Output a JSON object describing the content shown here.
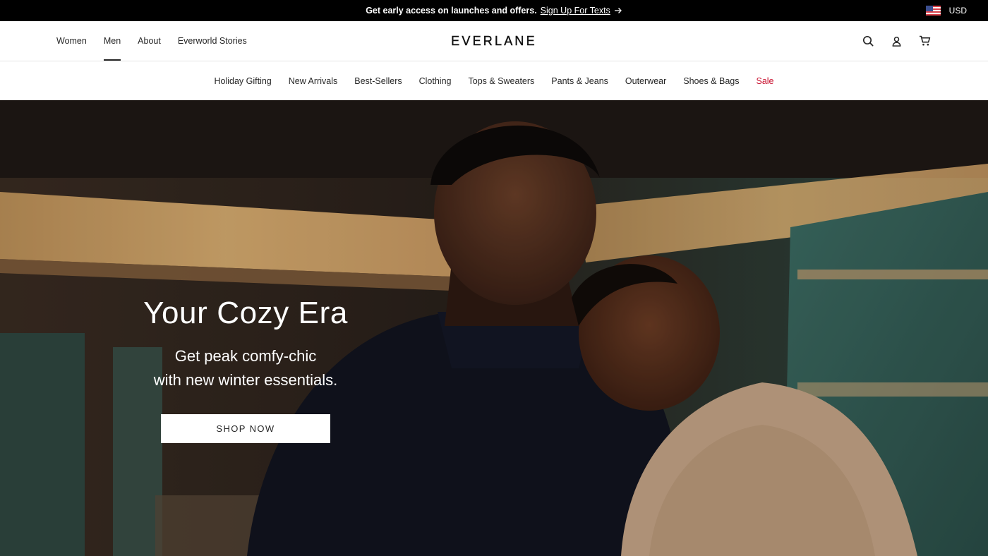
{
  "promo": {
    "text": "Get early access on launches and offers.",
    "link": "Sign Up For Texts",
    "currency": "USD"
  },
  "header": {
    "nav": [
      "Women",
      "Men",
      "About",
      "Everworld Stories"
    ],
    "active_nav": "Men",
    "logo": "EVERLANE",
    "icons": [
      "search-icon",
      "account-icon",
      "cart-icon"
    ]
  },
  "categories": [
    "Holiday Gifting",
    "New Arrivals",
    "Best-Sellers",
    "Clothing",
    "Tops & Sweaters",
    "Pants & Jeans",
    "Outerwear",
    "Shoes & Bags",
    "Sale"
  ],
  "hero": {
    "title": "Your Cozy Era",
    "subtitle_line1": "Get peak comfy-chic",
    "subtitle_line2": "with new winter essentials.",
    "cta": "SHOP NOW"
  },
  "colors": {
    "promo_bg": "#000000",
    "sale": "#c8102e",
    "text": "#262626"
  }
}
